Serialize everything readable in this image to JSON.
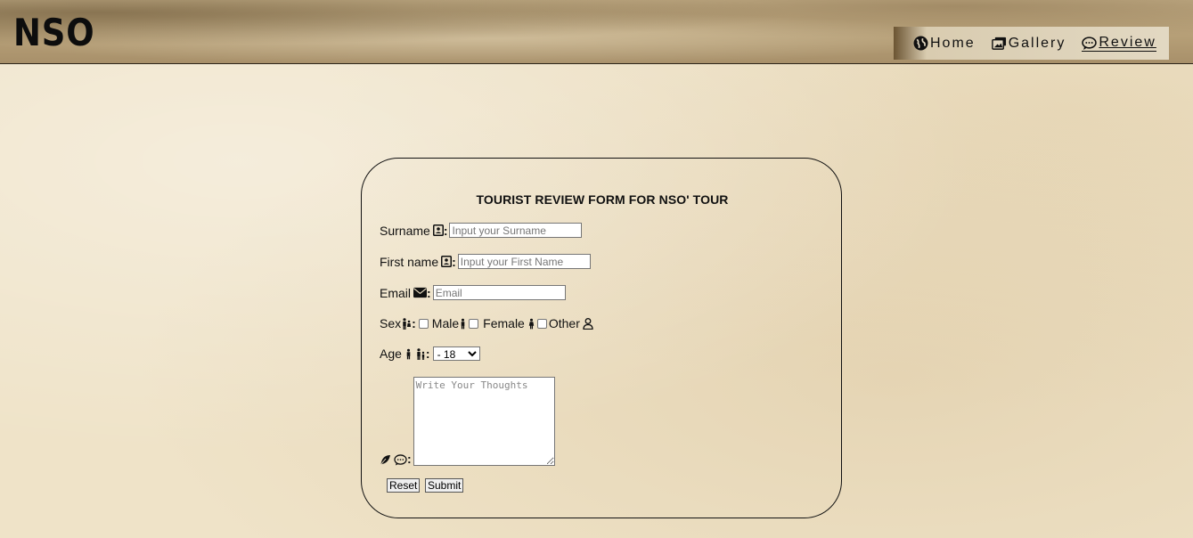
{
  "header": {
    "logo": "NSO",
    "nav": [
      {
        "label": "Home",
        "icon": "globe-icon"
      },
      {
        "label": "Gallery",
        "icon": "images-icon"
      },
      {
        "label": "Review",
        "icon": "comment-icon",
        "active": true
      }
    ]
  },
  "form": {
    "title": "TOURIST REVIEW FORM FOR NSO' TOUR",
    "surname": {
      "label": "Surname",
      "placeholder": "Input your Surname"
    },
    "first_name": {
      "label": "First name",
      "placeholder": "Input your First Name"
    },
    "email": {
      "label": "Email",
      "placeholder": "Email"
    },
    "sex": {
      "label": "Sex",
      "options": [
        "Male",
        "Female",
        "Other"
      ]
    },
    "age": {
      "label": "Age",
      "selected": "- 18"
    },
    "thoughts": {
      "placeholder": "Write Your Thoughts"
    },
    "colon": ":",
    "reset_label": "Reset",
    "submit_label": "Submit"
  }
}
